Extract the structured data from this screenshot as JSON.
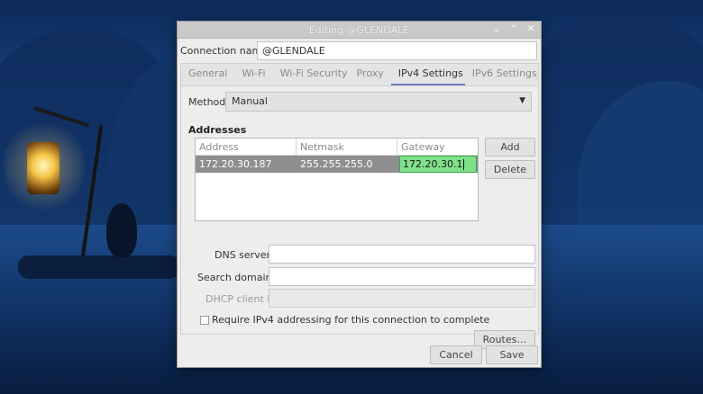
{
  "window": {
    "title": "Editing @GLENDALE",
    "controls": [
      "chevron-down-icon",
      "chevron-up-icon",
      "close-icon"
    ]
  },
  "connection": {
    "label": "Connection name",
    "value": "@GLENDALE"
  },
  "tabs": [
    {
      "label": "General",
      "active": false
    },
    {
      "label": "Wi-Fi",
      "active": false
    },
    {
      "label": "Wi-Fi Security",
      "active": false
    },
    {
      "label": "Proxy",
      "active": false
    },
    {
      "label": "IPv4 Settings",
      "active": true
    },
    {
      "label": "IPv6 Settings",
      "active": false
    }
  ],
  "ipv4": {
    "method_label": "Method",
    "method_value": "Manual",
    "addresses_heading": "Addresses",
    "columns": [
      "Address",
      "Netmask",
      "Gateway"
    ],
    "rows": [
      {
        "address": "172.20.30.187",
        "netmask": "255.255.255.0",
        "gateway": "172.20.30.1"
      }
    ],
    "add_label": "Add",
    "delete_label": "Delete",
    "dns_label": "DNS servers",
    "dns_value": "",
    "search_label": "Search domains",
    "search_value": "",
    "dhcp_label": "DHCP client ID",
    "dhcp_value": "",
    "require_label": "Require IPv4 addressing for this connection to complete",
    "require_checked": false,
    "routes_label": "Routes…"
  },
  "footer": {
    "cancel_label": "Cancel",
    "save_label": "Save"
  },
  "colors": {
    "edit_highlight": "#7fe08a",
    "selected_row": "#8f8f8f",
    "active_tab_underline": "#6e7dbf"
  }
}
